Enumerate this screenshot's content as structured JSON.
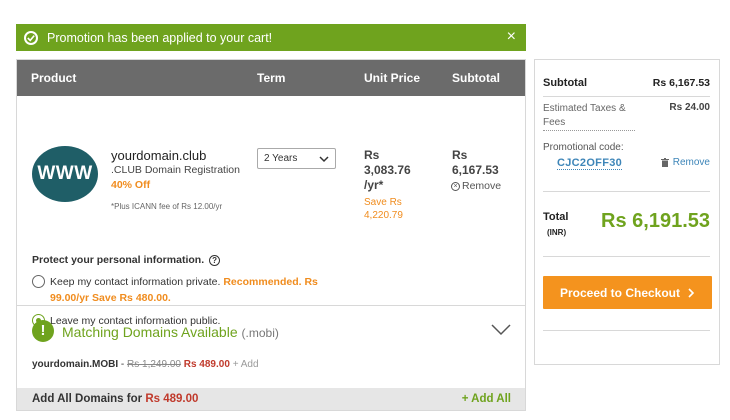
{
  "banner": {
    "message": "Promotion has been applied to your cart!",
    "close": "×",
    "color": "#6fa31e"
  },
  "table": {
    "headers": {
      "product": "Product",
      "term": "Term",
      "unit_price": "Unit Price",
      "subtotal": "Subtotal"
    }
  },
  "item": {
    "logo": "WWW",
    "domain": "yourdomain.club",
    "description": ".CLUB Domain Registration",
    "discount": "40% Off",
    "icann_note": "*Plus ICANN fee of Rs 12.00/yr",
    "term": "2 Years",
    "unit_price_line1": "Rs",
    "unit_price_line2": "3,083.76",
    "unit_price_line3": "/yr*",
    "save_line1": "Save Rs",
    "save_line2": "4,220.79",
    "subtotal_line1": "Rs",
    "subtotal_line2": "6,167.53",
    "remove": "Remove"
  },
  "privacy": {
    "heading": "Protect your personal information.",
    "help": "?",
    "option_private": "Keep my contact information private.",
    "option_private_promo": "Recommended. Rs 99.00/yr Save Rs 480.00.",
    "option_public": "Leave my contact information public.",
    "selected": "public"
  },
  "matching": {
    "icon": "!",
    "title": "Matching Domains Available",
    "tld": "(.mobi)",
    "suggestion_domain": "yourdomain.MOBI",
    "suggestion_sep": "-",
    "old_price": "Rs 1,249.00",
    "new_price": "Rs 489.00",
    "add": "+ Add",
    "add_all_label": "Add All Domains for",
    "add_all_price": "Rs 489.00",
    "add_all_button": "+ Add All"
  },
  "summary": {
    "subtotal_label": "Subtotal",
    "subtotal_value": "Rs 6,167.53",
    "taxes_label": "Estimated Taxes & Fees",
    "taxes_value": "Rs 24.00",
    "promo_label": "Promotional code:",
    "promo_code": "CJC2OFF30",
    "promo_remove": "Remove",
    "total_label": "Total",
    "total_currency": "(INR)",
    "total_value": "Rs 6,191.53",
    "checkout": "Proceed to Checkout"
  },
  "colors": {
    "green": "#6fa31e",
    "orange": "#f4931e",
    "header_gray": "#6b6b6b",
    "logo_teal": "#1f5e67",
    "link_blue": "#3d85b8"
  }
}
